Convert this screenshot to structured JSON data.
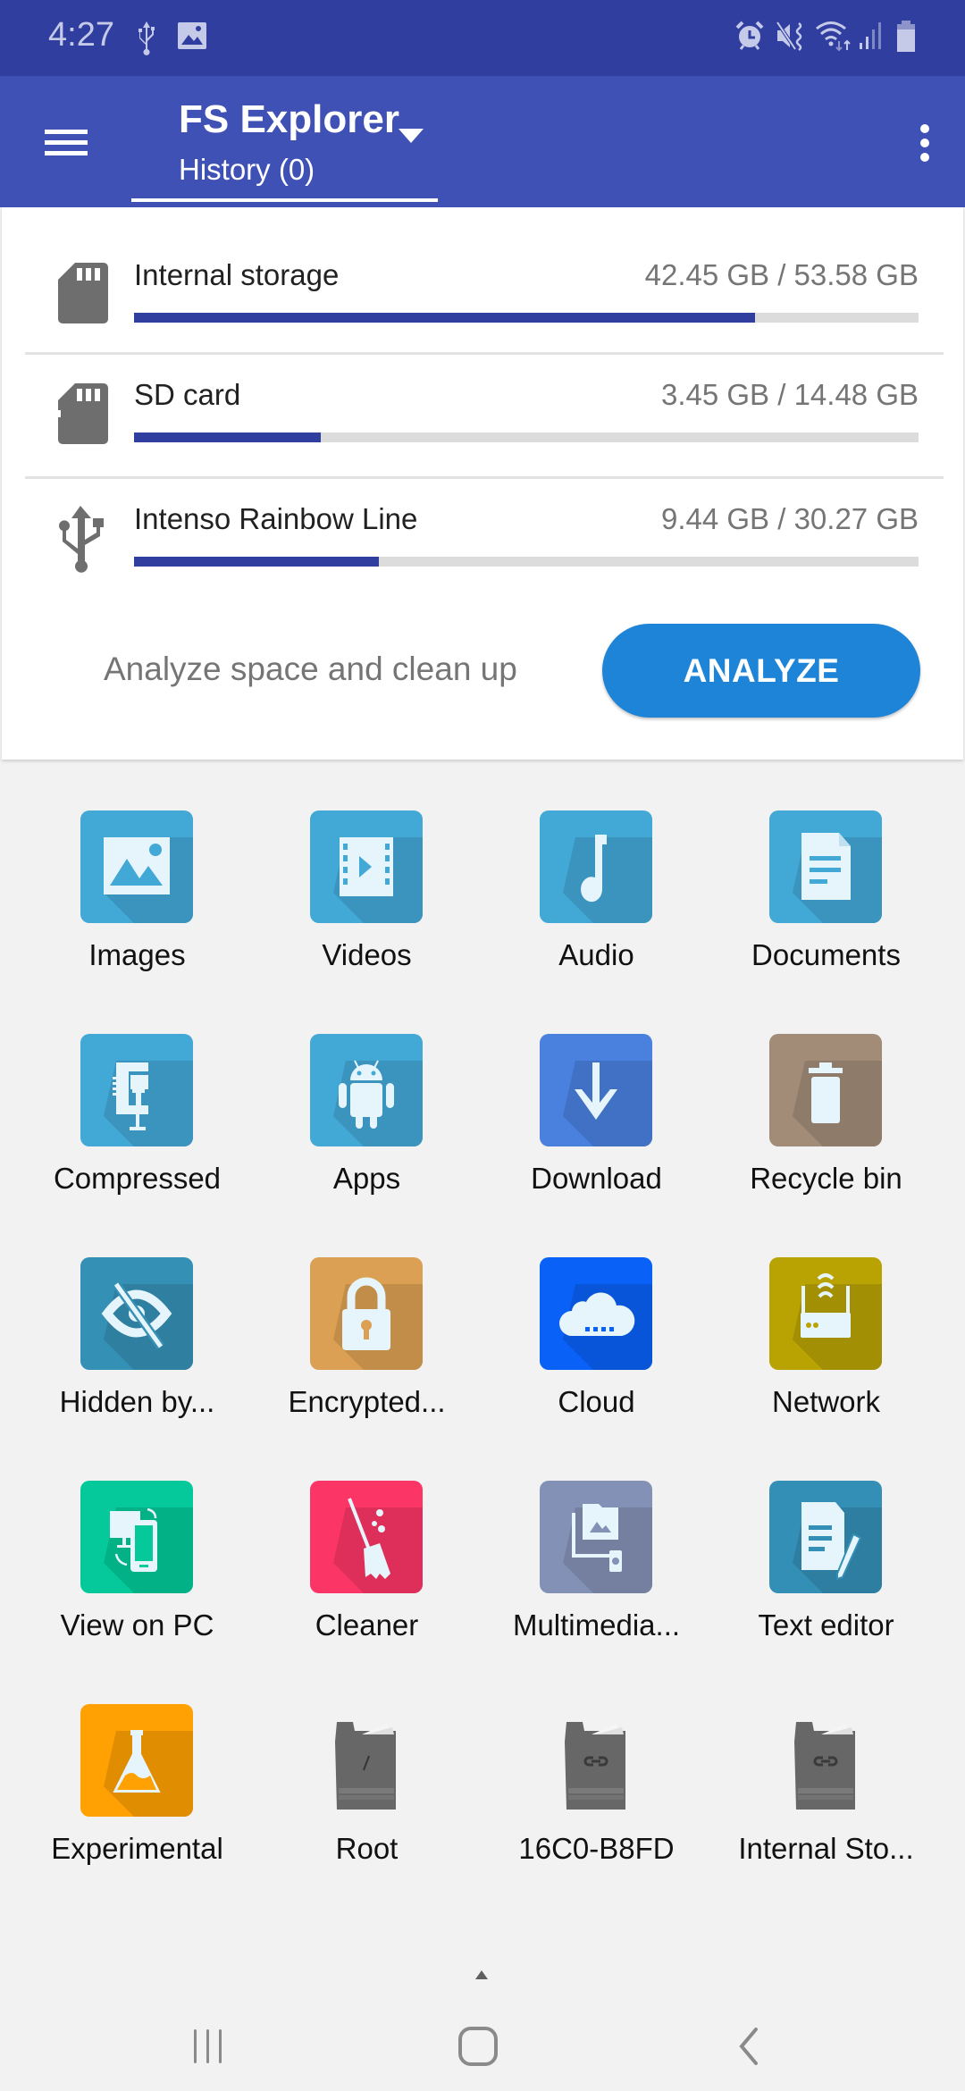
{
  "status_bar": {
    "time": "4:27",
    "left_icons": [
      "usb-icon",
      "image-notification-icon"
    ],
    "right_icons": [
      "alarm-icon",
      "vibrate-mute-icon",
      "wifi-icon",
      "signal-icon",
      "battery-icon"
    ]
  },
  "app_bar": {
    "title": "FS Explorer",
    "subtitle": "History (0)",
    "menu_icon": "hamburger-menu-icon",
    "overflow_icon": "more-vert-icon"
  },
  "storage": {
    "items": [
      {
        "name": "Internal storage",
        "size": "42.45 GB / 53.58 GB",
        "used_fraction": 0.792,
        "icon": "sd-card-icon"
      },
      {
        "name": "SD card",
        "size": "3.45 GB / 14.48 GB",
        "used_fraction": 0.238,
        "icon": "sd-card-icon"
      },
      {
        "name": "Intenso Rainbow Line",
        "size": "9.44 GB / 30.27 GB",
        "used_fraction": 0.312,
        "icon": "usb-icon"
      }
    ],
    "analyze_text": "Analyze space and clean up",
    "analyze_button": "ANALYZE"
  },
  "shortcuts": [
    {
      "label": "Images",
      "icon": "image-icon",
      "color": "#42a8d6"
    },
    {
      "label": "Videos",
      "icon": "video-icon",
      "color": "#42a8d6"
    },
    {
      "label": "Audio",
      "icon": "music-note-icon",
      "color": "#42a8d6"
    },
    {
      "label": "Documents",
      "icon": "document-icon",
      "color": "#42a8d6"
    },
    {
      "label": "Compressed",
      "icon": "clamp-icon",
      "color": "#42a8d6"
    },
    {
      "label": "Apps",
      "icon": "android-icon",
      "color": "#42a8d6"
    },
    {
      "label": "Download",
      "icon": "download-arrow-icon",
      "color": "#4a80de"
    },
    {
      "label": "Recycle bin",
      "icon": "trash-icon",
      "color": "#a28b77"
    },
    {
      "label": "Hidden by...",
      "icon": "eye-off-icon",
      "color": "#3590b6"
    },
    {
      "label": "Encrypted...",
      "icon": "lock-icon",
      "color": "#dba053"
    },
    {
      "label": "Cloud",
      "icon": "cloud-icon",
      "color": "#0961f7"
    },
    {
      "label": "Network",
      "icon": "router-icon",
      "color": "#b9a303"
    },
    {
      "label": "View on PC",
      "icon": "pc-phone-sync-icon",
      "color": "#05c99a"
    },
    {
      "label": "Cleaner",
      "icon": "broom-icon",
      "color": "#fb3566"
    },
    {
      "label": "Multimedia...",
      "icon": "media-folder-settings-icon",
      "color": "#8491b7"
    },
    {
      "label": "Text editor",
      "icon": "text-edit-icon",
      "color": "#348fb6"
    },
    {
      "label": "Experimental",
      "icon": "flask-icon",
      "color": "#ffa102"
    },
    {
      "label": "Root",
      "icon": "root-folder-icon",
      "color": "#676767"
    },
    {
      "label": "16C0-B8FD",
      "icon": "linked-folder-icon",
      "color": "#676767"
    },
    {
      "label": "Internal Sto...",
      "icon": "linked-folder-icon",
      "color": "#676767"
    }
  ],
  "nav_bar": {
    "recents": "recents-icon",
    "home": "home-icon",
    "back": "back-icon"
  }
}
